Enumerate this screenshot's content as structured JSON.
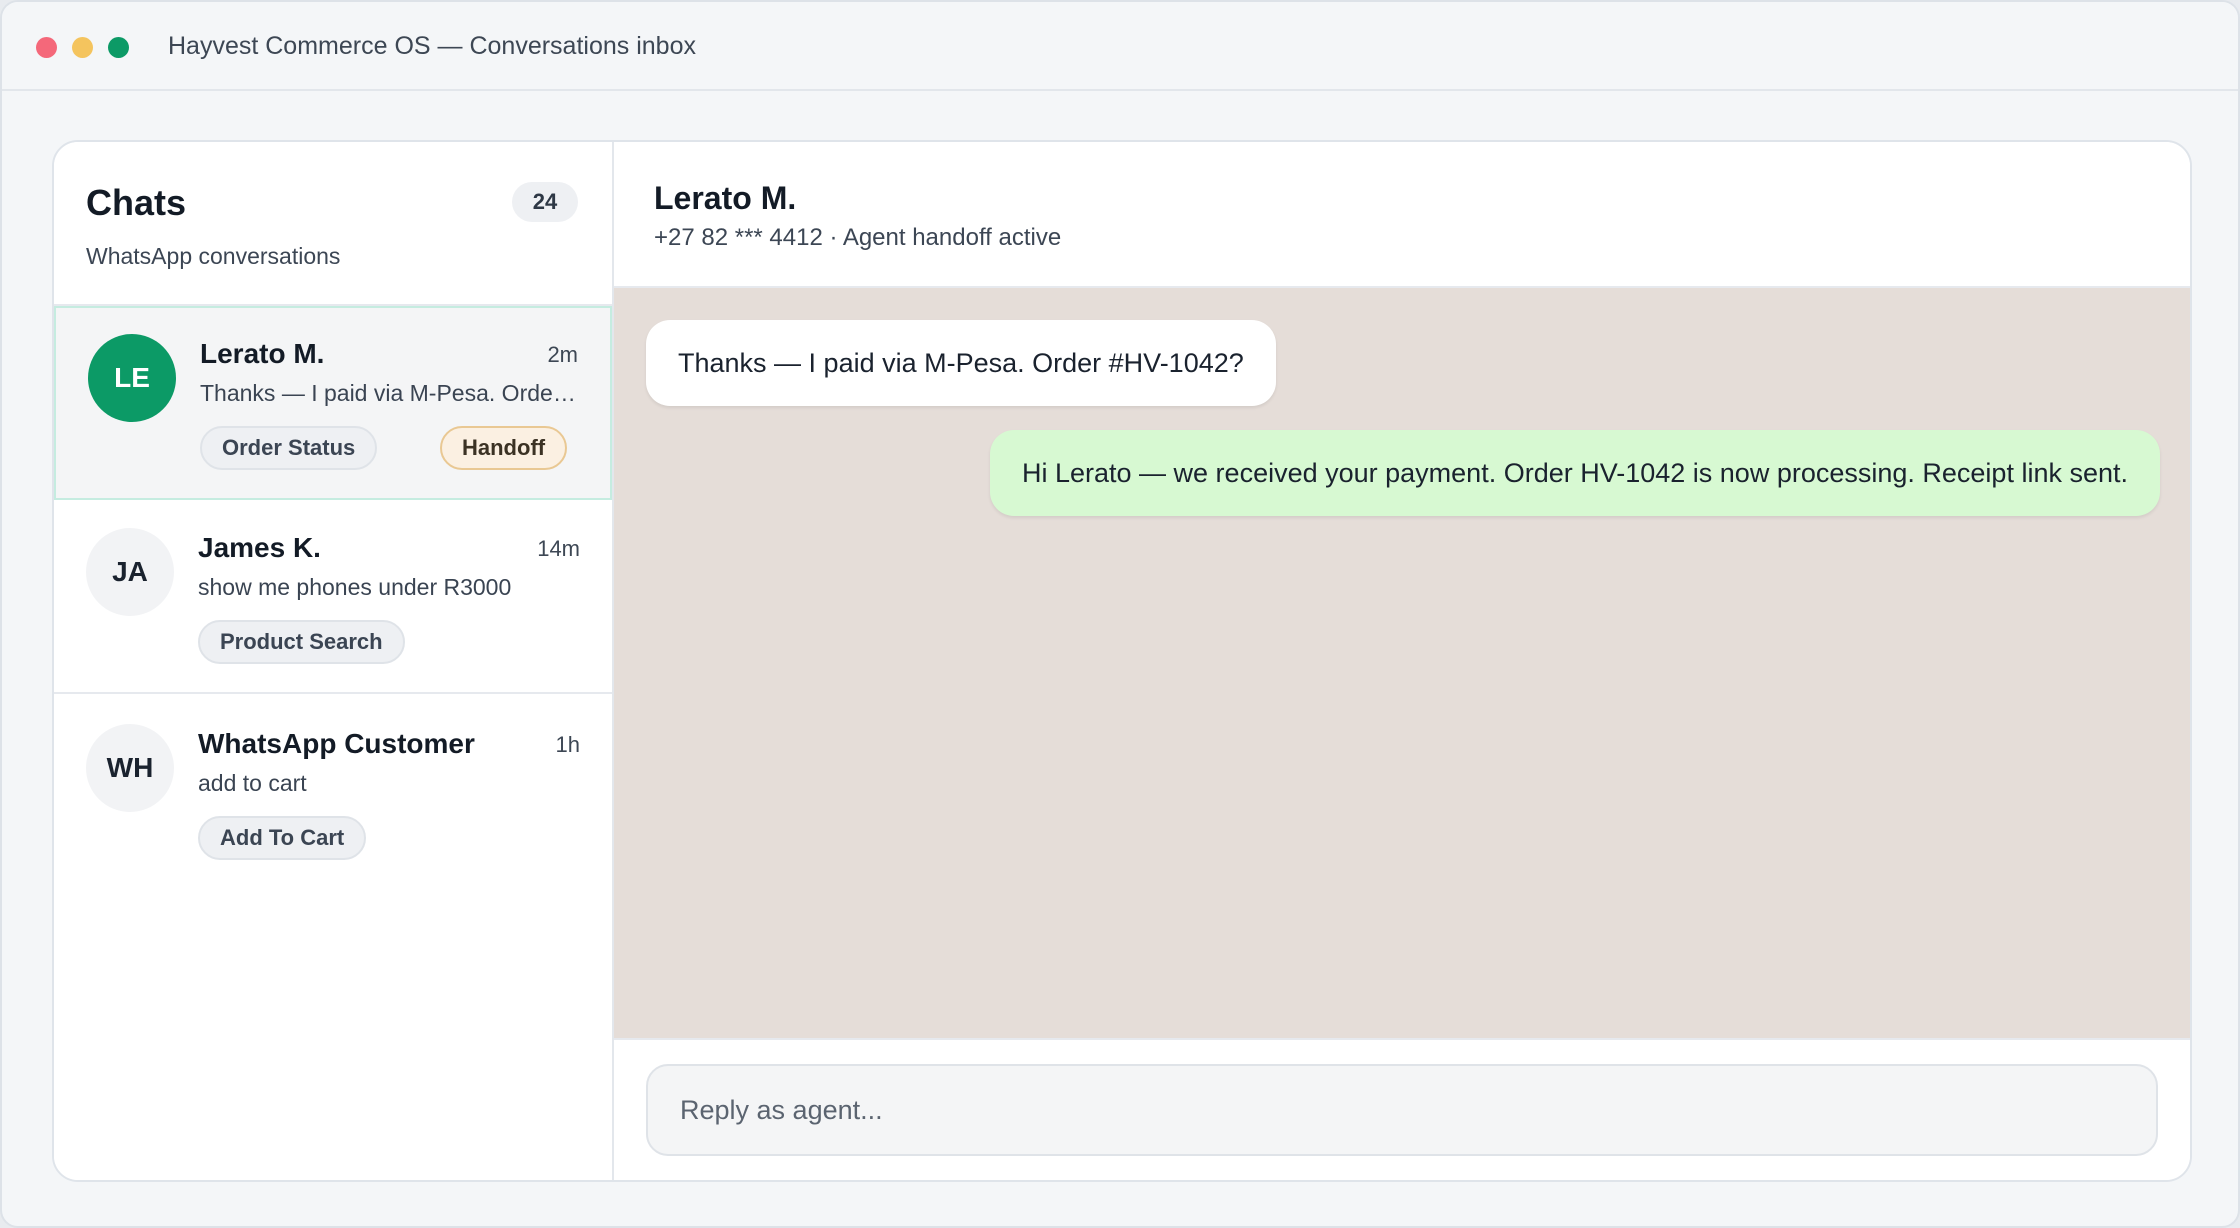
{
  "window": {
    "title": "Hayvest Commerce OS — Conversations inbox"
  },
  "sidebar": {
    "title": "Chats",
    "count": "24",
    "subtitle": "WhatsApp conversations",
    "chats": [
      {
        "initials": "LE",
        "name": "Lerato M.",
        "time": "2m",
        "preview": "Thanks — I paid via M-Pesa. Order #HV-1042?",
        "tags": [
          "Order Status",
          "Handoff"
        ],
        "active": true
      },
      {
        "initials": "JA",
        "name": "James K.",
        "time": "14m",
        "preview": "show me phones under R3000",
        "tags": [
          "Product Search"
        ],
        "active": false
      },
      {
        "initials": "WH",
        "name": "WhatsApp Customer",
        "time": "1h",
        "preview": "add to cart",
        "tags": [
          "Add To Cart"
        ],
        "active": false
      }
    ]
  },
  "conversation": {
    "name": "Lerato M.",
    "subtitle": "+27 82 *** 4412 · Agent handoff active",
    "messages": [
      {
        "direction": "in",
        "text": "Thanks — I paid via M-Pesa. Order #HV-1042?"
      },
      {
        "direction": "out",
        "text": "Hi Lerato — we received your payment. Order HV-1042 is now processing. Receipt link sent."
      }
    ],
    "reply_placeholder": "Reply as agent..."
  },
  "colors": {
    "brand_green": "#0c9a66",
    "outgoing_bubble": "#d7f9d2",
    "chat_background": "#e5ddd8",
    "handoff_tag_border": "#e9c893"
  },
  "icons": {
    "window_controls": [
      "close-dot",
      "minimize-dot",
      "maximize-dot"
    ]
  }
}
